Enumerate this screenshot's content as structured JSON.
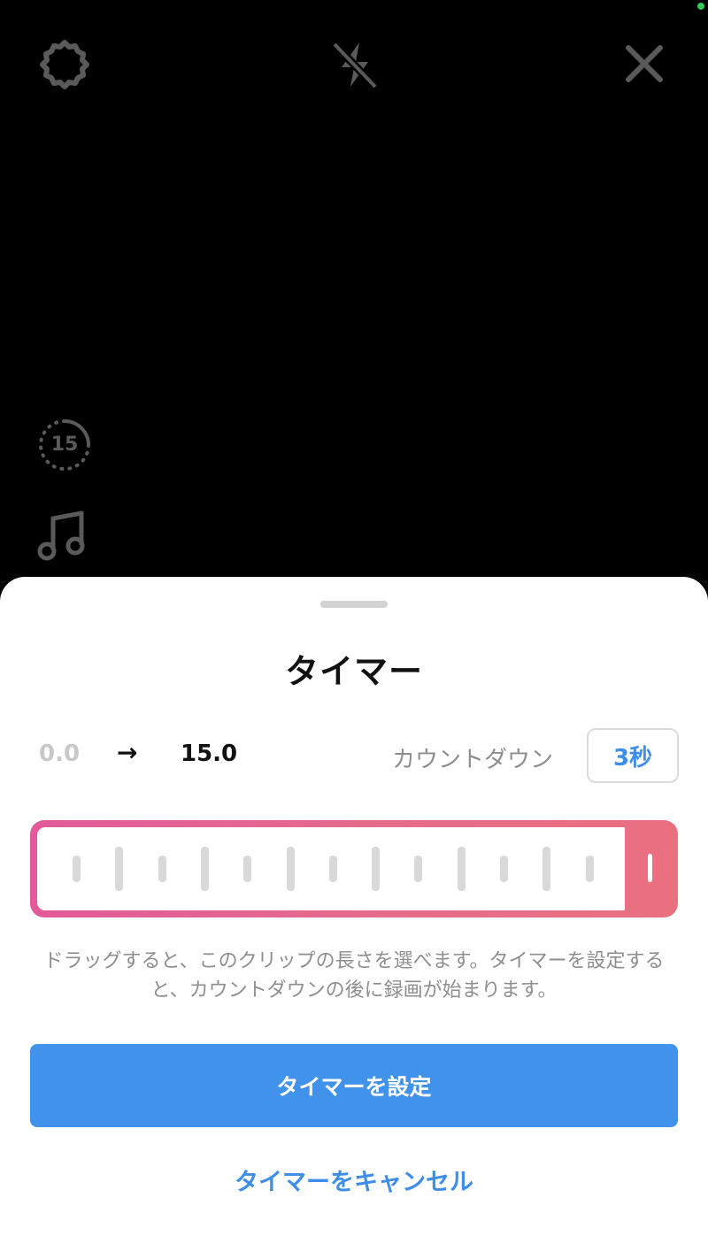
{
  "camera": {
    "top_left_icon": "settings-gear-icon",
    "top_center_icon": "flash-off-icon",
    "top_right_icon": "close-icon",
    "length_value": "15",
    "music_icon": "music-note-icon"
  },
  "sheet": {
    "title": "タイマー",
    "range": {
      "start": "0.0",
      "arrow": "→",
      "end": "15.0"
    },
    "countdown": {
      "label": "カウントダウン",
      "value": "3秒"
    },
    "timeline": {
      "selected_fraction": 1.0,
      "tick_count": 13
    },
    "help_text": "ドラッグすると、このクリップの長さを選べます。タイマーを設定すると、カウントダウンの後に録画が始まります。",
    "primary_button": "タイマーを設定",
    "cancel_button": "タイマーをキャンセル"
  },
  "colors": {
    "accent": "#4092ea",
    "timeline_start": "#e25a9a",
    "timeline_end": "#ea7080",
    "status_dot": "#34c759"
  }
}
